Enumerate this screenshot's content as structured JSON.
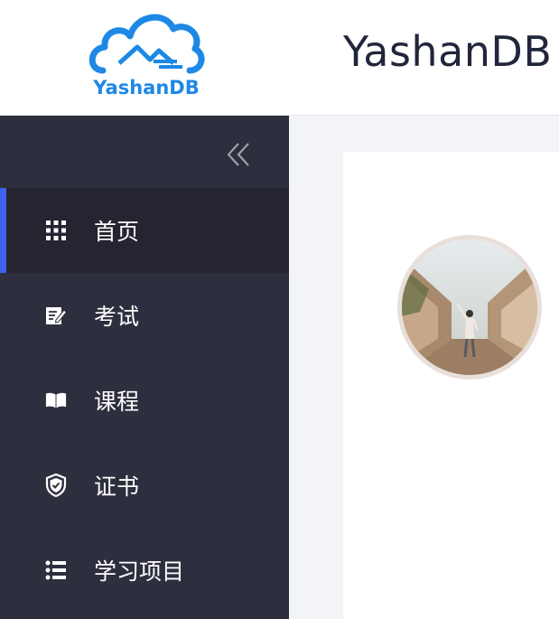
{
  "header": {
    "logo_text": "YashanDB",
    "title": "YashanDB"
  },
  "sidebar": {
    "collapse_icon": "double-chevron-left-icon",
    "items": [
      {
        "label": "首页",
        "icon": "grid-icon",
        "active": true
      },
      {
        "label": "考试",
        "icon": "edit-note-icon",
        "active": false
      },
      {
        "label": "课程",
        "icon": "open-book-icon",
        "active": false
      },
      {
        "label": "证书",
        "icon": "shield-check-icon",
        "active": false
      },
      {
        "label": "学习项目",
        "icon": "list-icon",
        "active": false
      }
    ]
  },
  "colors": {
    "accent": "#3f63f0",
    "sidebar_bg": "#2e2f3e",
    "logo_blue": "#1e88e5"
  }
}
